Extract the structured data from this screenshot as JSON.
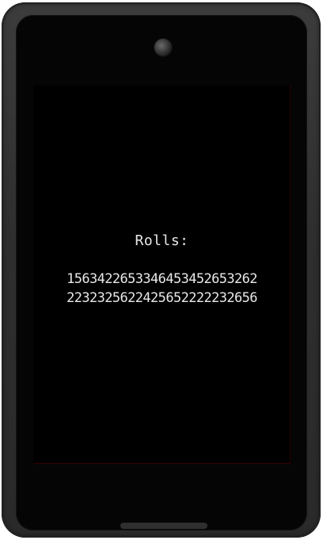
{
  "app": {
    "heading": "Rolls:",
    "rolls_lines": [
      "1563422653346453452653262",
      "2232325622425652222232656"
    ]
  },
  "colors": {
    "screen_background": "#000000",
    "text": "#e8e8e8",
    "device_frame": "#333333"
  }
}
